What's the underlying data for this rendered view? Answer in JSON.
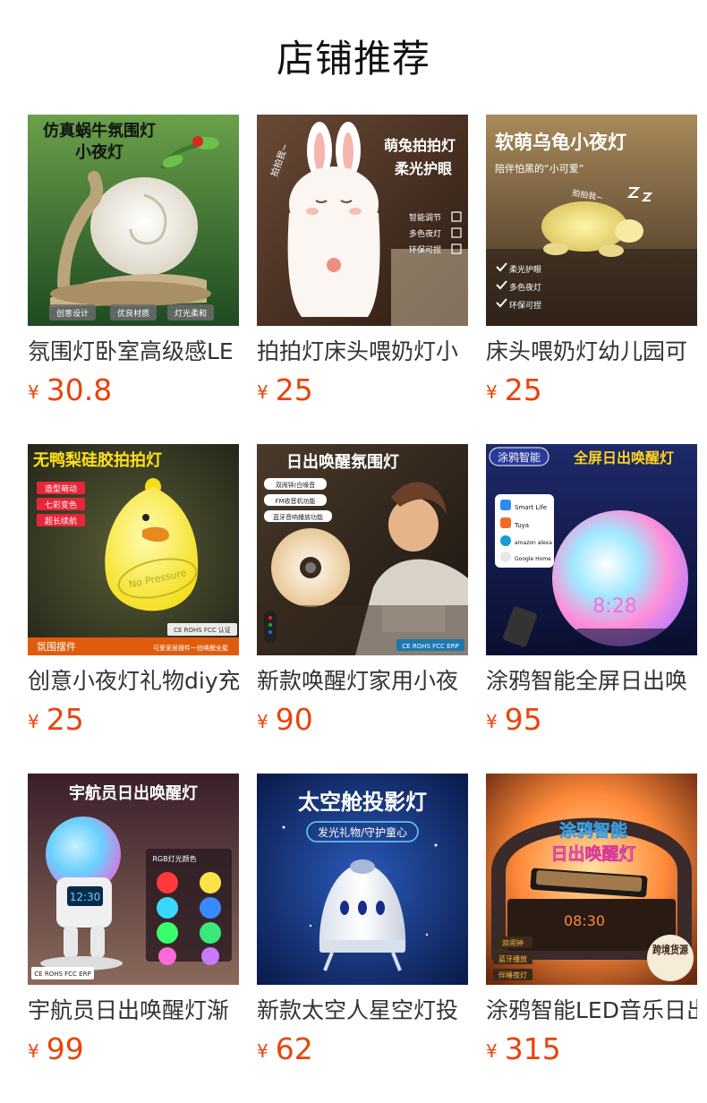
{
  "section_title": "店铺推荐",
  "currency": "¥",
  "products": [
    {
      "name": "氛围灯卧室高级感LE",
      "price": "30.8",
      "image": {
        "headline": "仿真蜗牛氛围灯",
        "subline": "小夜灯",
        "tags": [
          "创意设计",
          "优良材质",
          "灯光柔和"
        ]
      }
    },
    {
      "name": "拍拍灯床头喂奶灯小",
      "price": "25",
      "image": {
        "headline": "萌兔拍拍灯",
        "subline": "柔光护眼",
        "tags": [
          "智能调节",
          "多色夜灯",
          "环保可捏"
        ],
        "side_text": "拍拍我~"
      }
    },
    {
      "name": "床头喂奶灯幼儿园可",
      "price": "25",
      "image": {
        "headline": "软萌乌龟小夜灯",
        "subline": "陪伴怕黑的“小可爱”",
        "tags": [
          "柔光护眼",
          "多色夜灯",
          "环保可捏"
        ],
        "side_text": "拍拍我~"
      }
    },
    {
      "name": "创意小夜灯礼物diy充",
      "price": "25",
      "image": {
        "headline": "无鸭梨硅胶拍拍灯",
        "tags": [
          "造型萌动",
          "七彩变色",
          "超长续航"
        ],
        "body_text": "No Pressure",
        "cert": "CE ROHS FCC 认证",
        "footer": "氛围摆件",
        "footer_note": "可爱家居摆件一拍唤醒全屋"
      }
    },
    {
      "name": "新款唤醒灯家用小夜",
      "price": "90",
      "image": {
        "headline": "日出唤醒氛围灯",
        "tags": [
          "双闹钟/白噪音",
          "FM收音机功能",
          "蓝牙音响播放功能"
        ],
        "cert": "CE ROHS FCC ERP"
      }
    },
    {
      "name": "涂鸦智能全屏日出唤",
      "price": "95",
      "image": {
        "badge": "涂鸦智能",
        "headline": "全屏日出唤醒灯",
        "tags": [
          "Smart Life",
          "Tuya",
          "amazon alexa",
          "Google Home"
        ],
        "clock": "8:28"
      }
    },
    {
      "name": "宇航员日出唤醒灯渐",
      "price": "99",
      "image": {
        "headline": "宇航员日出唤醒灯",
        "subline": "RGB灯光颜色",
        "clock": "12:30",
        "cert": "CE ROHS FCC ERP"
      }
    },
    {
      "name": "新款太空人星空灯投",
      "price": "62",
      "image": {
        "headline": "太空舱投影灯",
        "subline": "发光礼物/守护童心"
      }
    },
    {
      "name": "涂鸦智能LED音乐日出",
      "price": "315",
      "image": {
        "headline": "涂鸦智能",
        "subline": "日出唤醒灯",
        "tags": [
          "双闹钟",
          "蓝牙播放",
          "伴睡夜灯"
        ],
        "badge": "跨境货源",
        "clock": "08:30"
      }
    }
  ],
  "colors": {
    "price": "#e8440c",
    "title": "#111111",
    "name": "#333333"
  }
}
